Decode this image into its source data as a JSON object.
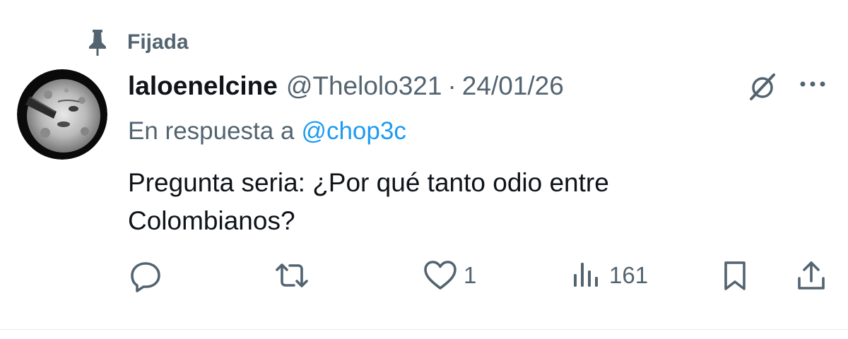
{
  "pinned": {
    "label": "Fijada",
    "icon": "pin-icon"
  },
  "tweet": {
    "display_name": "laloenelcine",
    "handle": "@Thelolo321",
    "separator": "·",
    "date": "24/01/26",
    "reply_prefix": "En respuesta a",
    "reply_to": "@chop3c",
    "text_line1": "Pregunta seria: ¿Por qué tanto odio entre",
    "text_line2": "Colombianos?",
    "avatar": "moon-face-avatar"
  },
  "actions": {
    "reply": {
      "icon": "reply-icon"
    },
    "retweet": {
      "icon": "retweet-icon"
    },
    "like": {
      "icon": "heart-icon",
      "count": "1"
    },
    "views": {
      "icon": "views-icon",
      "count": "161"
    },
    "bookmark": {
      "icon": "bookmark-icon"
    },
    "share": {
      "icon": "share-icon"
    }
  },
  "colors": {
    "text_primary": "#0f1419",
    "text_secondary": "#536471",
    "link": "#1d9bf0",
    "icon": "#536471"
  }
}
